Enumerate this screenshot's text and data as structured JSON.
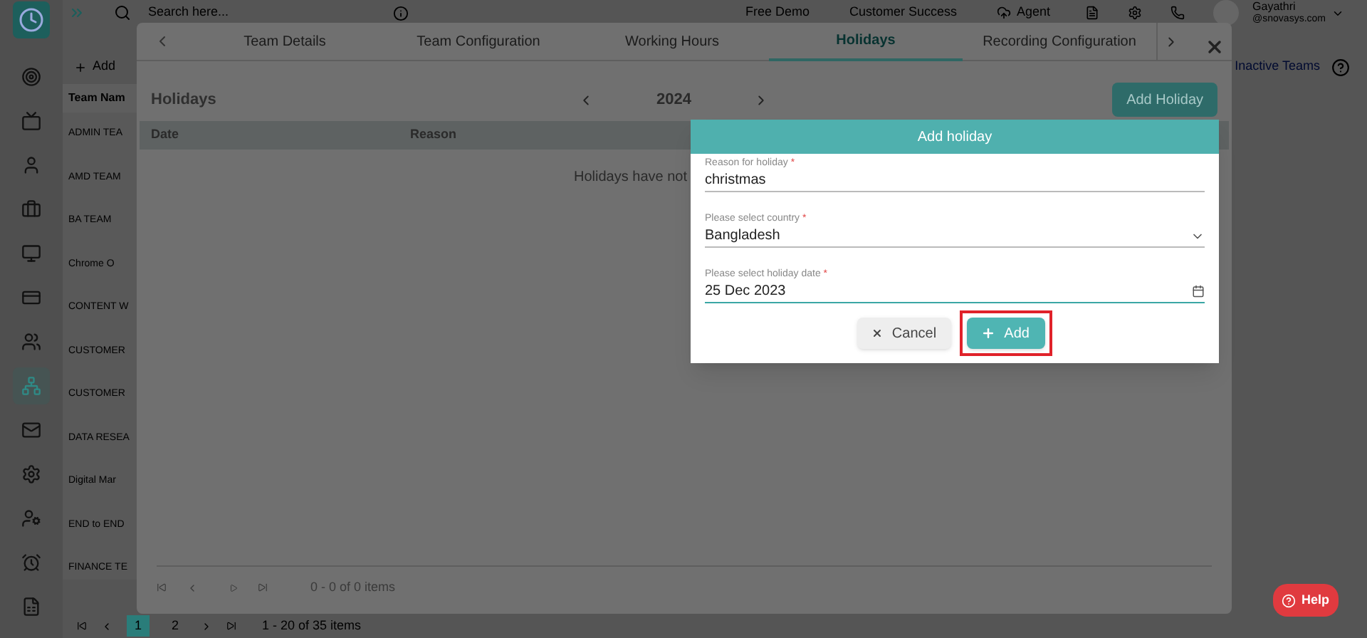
{
  "topbar": {
    "search": {
      "placeholder": "Search here..."
    },
    "links": [
      "Free Demo",
      "Customer Success"
    ],
    "agent": "Agent",
    "user": {
      "name": "Gayathri",
      "email": "@snovasys.com"
    }
  },
  "sidebar": {
    "items": [
      {
        "selected": false
      },
      {
        "selected": false
      },
      {
        "selected": false
      },
      {
        "selected": false
      },
      {
        "selected": false
      },
      {
        "selected": false
      },
      {
        "selected": false
      },
      {
        "selected": true
      },
      {
        "selected": false
      },
      {
        "selected": false
      },
      {
        "selected": false
      },
      {
        "selected": false
      },
      {
        "selected": false
      }
    ]
  },
  "teams_page": {
    "add_button": "Add",
    "inactive_link": "Inactive Teams",
    "column": "Team Nam",
    "rows": [
      "ADMIN TEA",
      "AMD TEAM",
      "BA TEAM",
      "Chrome O",
      "CONTENT W",
      "CUSTOMER",
      "CUSTOMER",
      "DATA RESEA",
      "Digital Mar",
      "END to END",
      "FINANCE TE"
    ],
    "pagination": {
      "pages": [
        {
          "label": "1",
          "selected": true
        },
        {
          "label": "2",
          "selected": false
        }
      ],
      "summary": "1 - 20 of 35 items"
    }
  },
  "team_modal": {
    "tabs": [
      {
        "label": "Team Details",
        "selected": false
      },
      {
        "label": "Team Configuration",
        "selected": false
      },
      {
        "label": "Working Hours",
        "selected": false
      },
      {
        "label": "Holidays",
        "selected": true
      },
      {
        "label": "Recording Configuration",
        "selected": false
      }
    ],
    "title": "Holidays",
    "year": "2024",
    "add_button": "Add Holiday",
    "columns": [
      "Date",
      "Reason"
    ],
    "empty_message": "Holidays have not",
    "pager_summary": "0 - 0 of 0 items"
  },
  "dialog": {
    "title": "Add holiday",
    "fields": [
      {
        "kind": "text",
        "label": "Reason for holiday",
        "required_mark": "*",
        "value": "christmas",
        "focused": false
      },
      {
        "kind": "select",
        "label": "Please select country",
        "required_mark": "*",
        "value": "Bangladesh",
        "focused": false
      },
      {
        "kind": "date",
        "label": "Please select holiday date",
        "required_mark": "*",
        "value": "25 Dec 2023",
        "focused": true
      }
    ],
    "buttons": [
      {
        "kind": "cancel",
        "label": "Cancel",
        "highlighted": false
      },
      {
        "kind": "add",
        "label": "Add",
        "highlighted": true
      }
    ]
  },
  "help_button": "Help"
}
